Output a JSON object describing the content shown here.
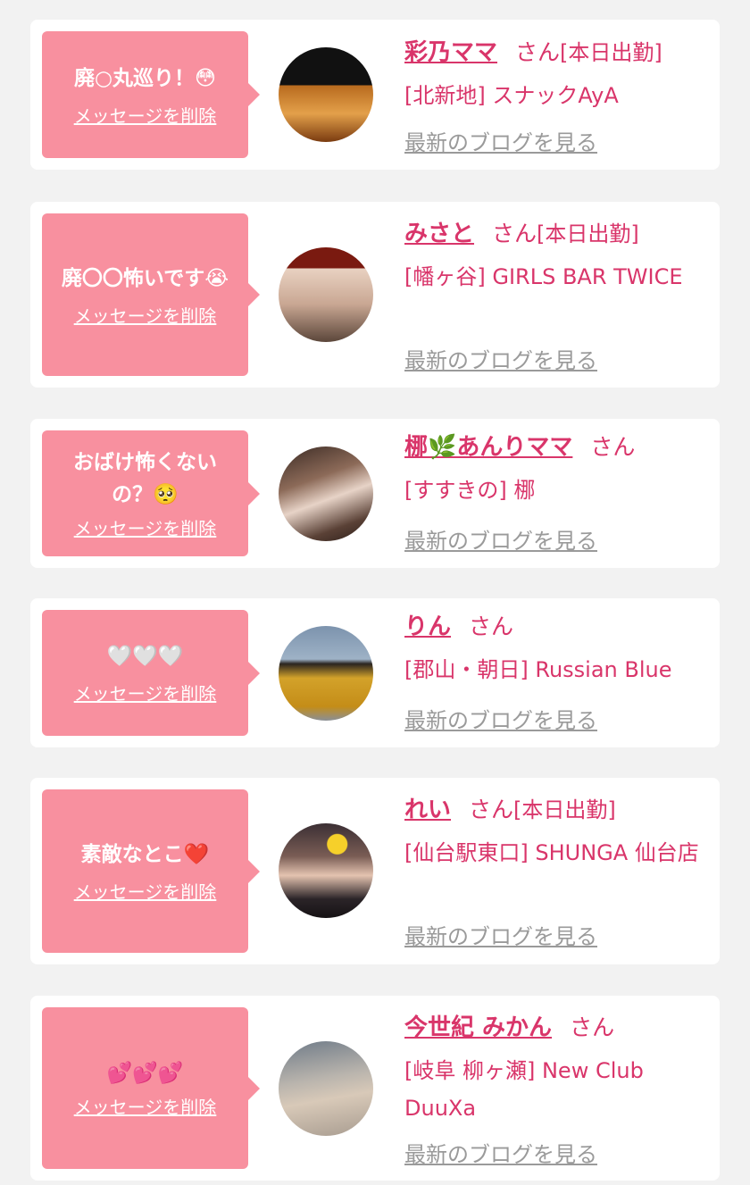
{
  "labels": {
    "delete_message": "メッセージを削除",
    "view_blog": "最新のブログを見る",
    "san": "さん"
  },
  "cards": [
    {
      "message": "廃○丸巡り！😳",
      "name": "彩乃ママ",
      "status": "[本日出勤]",
      "shop": "[北新地] スナックAyA"
    },
    {
      "message": "廃〇〇怖いです😭",
      "name": "みさと",
      "status": "[本日出勤]",
      "shop": "[幡ヶ谷] GIRLS BAR TWICE"
    },
    {
      "message": "おばけ怖くないの？🥺",
      "name": "梛🌿あんりママ",
      "status": "",
      "shop": "[すすきの] 梛"
    },
    {
      "message": "🤍🤍🤍",
      "name": "りん",
      "status": "",
      "shop": "[郡山・朝日] Russian Blue"
    },
    {
      "message": "素敵なとこ❤️",
      "name": "れい",
      "status": "[本日出勤]",
      "shop": "[仙台駅東口] SHUNGA 仙台店"
    },
    {
      "message": "💕💕💕",
      "name": "今世紀 みかん",
      "status": "",
      "shop": "[岐阜 柳ヶ瀬] New Club DuuXa"
    }
  ],
  "colors": {
    "background": "#f2f2f2",
    "bubble": "#f8909f",
    "accent": "#d9356a",
    "muted": "#9a9a9a"
  }
}
